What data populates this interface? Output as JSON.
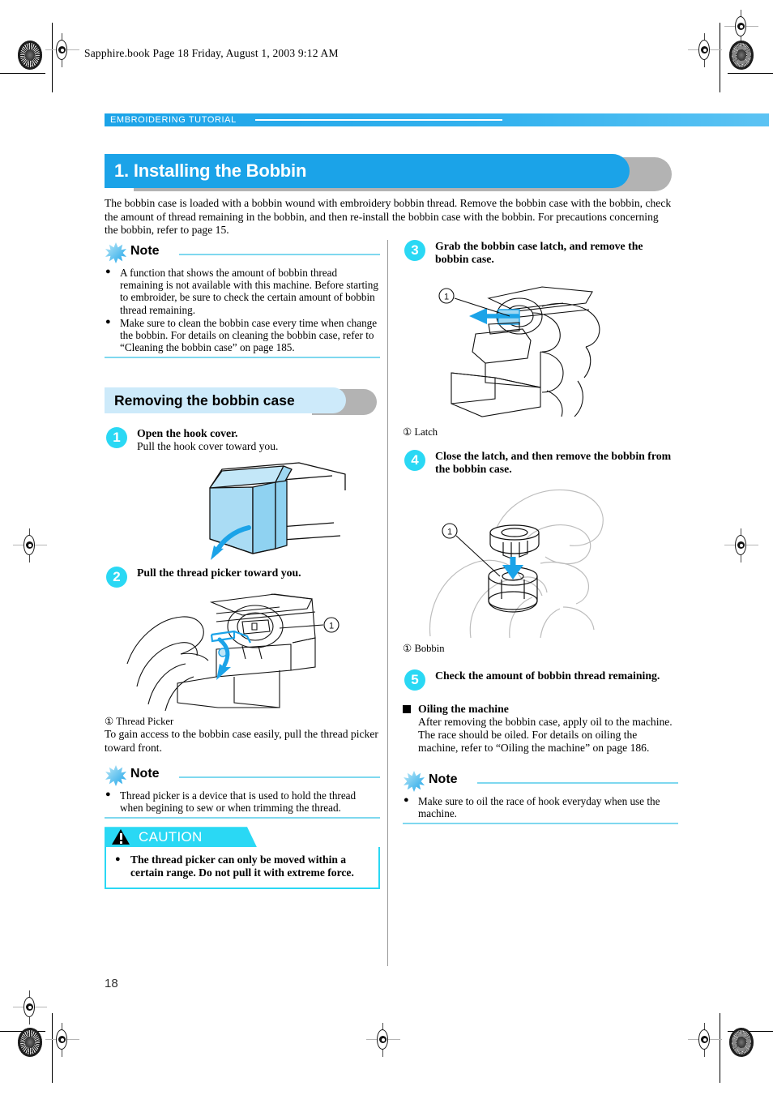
{
  "prepress": {
    "filestamp": "Sapphire.book  Page 18  Friday, August 1, 2003  9:12 AM"
  },
  "header": {
    "running_head": "EMBROIDERING TUTORIAL"
  },
  "title": {
    "text": "1. Installing the Bobbin",
    "accent_color": "#1ba3e8",
    "shadow_color": "#b3b3b3"
  },
  "intro": "The bobbin case is loaded with a bobbin wound with embroidery bobbin thread. Remove the bobbin case with the bobbin, check the amount of thread remaining in the bobbin, and then re-install the bobbin case with the bobbin. For precautions concerning the bobbin, refer to page 15.",
  "note_top": {
    "label": "Note",
    "items": [
      "A function that shows the amount of bobbin thread remaining is not available with this machine. Before starting to embroider, be sure to check the certain amount of bobbin thread remaining.",
      "Make sure to clean the bobbin case every time when change the bobbin. For details on cleaning the bobbin case, refer to “Cleaning the bobbin case” on page 185."
    ]
  },
  "section": {
    "heading": "Removing the bobbin case",
    "fill_color": "#cdeafa"
  },
  "steps": {
    "one": {
      "num": "1",
      "title": "Open the hook cover.",
      "sub": "Pull the hook cover toward you."
    },
    "two": {
      "num": "2",
      "title": "Pull the thread picker toward you.",
      "caption": "① Thread Picker",
      "body": "To gain access to the bobbin case easily, pull the thread picker toward front."
    },
    "three": {
      "num": "3",
      "title": "Grab the bobbin case latch, and remove the bobbin case.",
      "caption": "① Latch"
    },
    "four": {
      "num": "4",
      "title": "Close the latch, and then remove the bobbin from the bobbin case.",
      "caption": "① Bobbin"
    },
    "five": {
      "num": "5",
      "title": "Check the amount of bobbin thread remaining."
    }
  },
  "oiling": {
    "heading": "Oiling the machine",
    "body": "After removing the bobbin case, apply oil to the machine. The race should be oiled. For details on oiling the machine, refer to “Oiling the machine” on page 186."
  },
  "note_bottom": {
    "label": "Note",
    "items": [
      "Make sure to oil the race of hook everyday when use the machine."
    ]
  },
  "caution": {
    "label": "CAUTION",
    "items": [
      "The thread picker can only be moved within a certain range. Do not pull it with extreme force."
    ],
    "accent_color": "#2ad8f4"
  },
  "footer": {
    "page_number": "18"
  },
  "callout_marker": "①"
}
